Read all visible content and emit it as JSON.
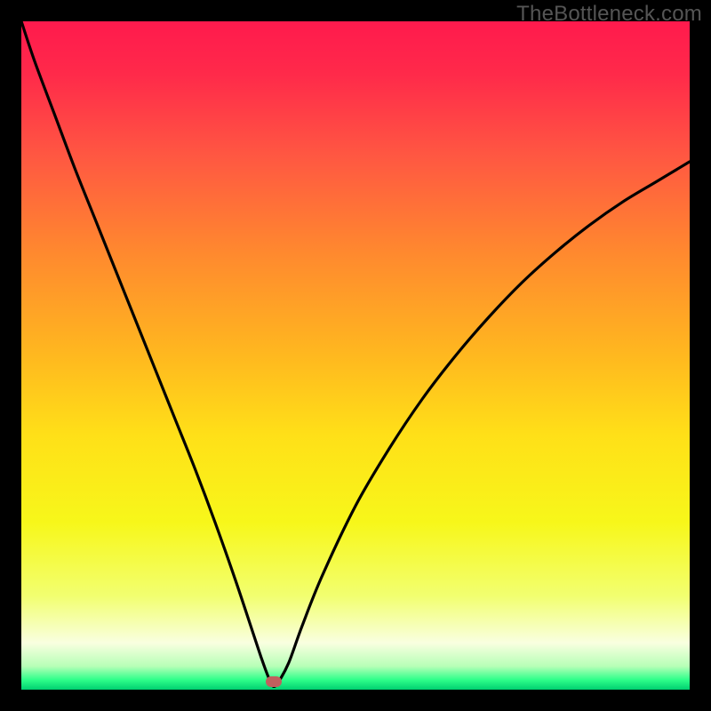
{
  "watermark": "TheBottleneck.com",
  "gradient": {
    "stops": [
      {
        "offset": 0.0,
        "color": "#ff1a4d"
      },
      {
        "offset": 0.08,
        "color": "#ff2a4a"
      },
      {
        "offset": 0.2,
        "color": "#ff5742"
      },
      {
        "offset": 0.35,
        "color": "#ff8a2e"
      },
      {
        "offset": 0.5,
        "color": "#ffb81f"
      },
      {
        "offset": 0.62,
        "color": "#ffe018"
      },
      {
        "offset": 0.75,
        "color": "#f7f71a"
      },
      {
        "offset": 0.86,
        "color": "#f2ff70"
      },
      {
        "offset": 0.93,
        "color": "#f9ffe0"
      },
      {
        "offset": 0.965,
        "color": "#b7ffb7"
      },
      {
        "offset": 0.985,
        "color": "#2fff8a"
      },
      {
        "offset": 1.0,
        "color": "#00d070"
      }
    ]
  },
  "chart_data": {
    "type": "line",
    "title": "",
    "xlabel": "",
    "ylabel": "",
    "xlim": [
      0,
      100
    ],
    "ylim": [
      0,
      100
    ],
    "series": [
      {
        "name": "bottleneck-curve",
        "x": [
          0,
          2,
          5,
          8,
          11,
          14,
          17,
          20,
          23,
          26,
          29,
          32,
          34.5,
          36,
          37,
          37.7,
          38.5,
          40,
          42,
          45,
          50,
          55,
          60,
          65,
          70,
          75,
          80,
          85,
          90,
          95,
          100
        ],
        "y": [
          100,
          94,
          86,
          78,
          70.5,
          63,
          55.5,
          48,
          40.5,
          33,
          25,
          16.5,
          9,
          4.5,
          1.8,
          0.5,
          1.2,
          4,
          9.5,
          17,
          27.5,
          36,
          43.5,
          50,
          55.8,
          61,
          65.5,
          69.5,
          73,
          76,
          79
        ]
      }
    ],
    "marker": {
      "x": 37.7,
      "y": 1.2,
      "color": "#c0605e"
    },
    "notes": "Vertical gradient background from a hot color (top, high bottleneck) to an optimal color (bottom, low bottleneck). The curve reaches its minimum near x≈37.7%."
  }
}
